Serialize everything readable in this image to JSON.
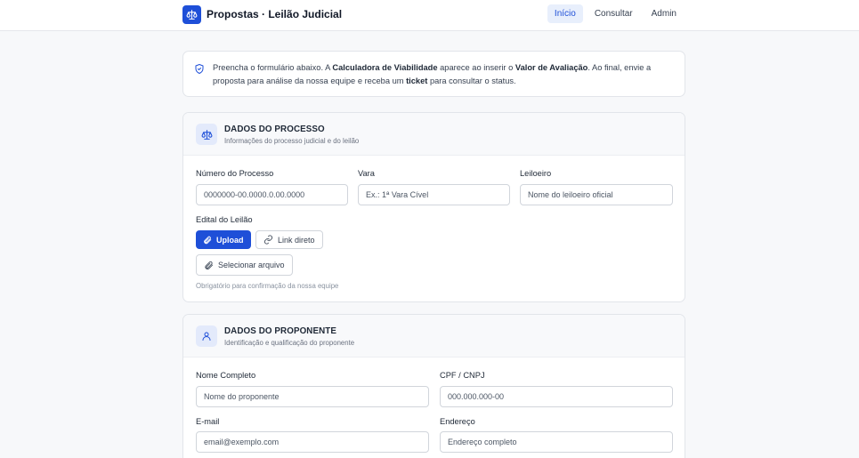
{
  "header": {
    "title": "Propostas · Leilão Judicial",
    "nav": [
      {
        "label": "Início"
      },
      {
        "label": "Consultar"
      },
      {
        "label": "Admin"
      }
    ]
  },
  "notice": {
    "t1": "Preencha o formulário abaixo. A ",
    "b1": "Calculadora de Viabilidade",
    "t2": " aparece ao inserir o ",
    "b2": "Valor de Avaliação",
    "t3": ". Ao final, envie a proposta para análise da nossa equipe e receba um ",
    "b3": "ticket",
    "t4": " para consultar o status."
  },
  "processo": {
    "title": "DADOS DO PROCESSO",
    "subtitle": "Informações do processo judicial e do leilão",
    "numero_label": "Número do Processo",
    "numero_placeholder": "0000000-00.0000.0.00.0000",
    "vara_label": "Vara",
    "vara_placeholder": "Ex.: 1ª Vara Cível",
    "leiloeiro_label": "Leiloeiro",
    "leiloeiro_placeholder": "Nome do leiloeiro oficial",
    "edital_label": "Edital do Leilão",
    "upload_label": "Upload",
    "link_label": "Link direto",
    "select_label": "Selecionar arquivo",
    "hint": "Obrigatório para confirmação da nossa equipe"
  },
  "proponente": {
    "title": "DADOS DO PROPONENTE",
    "subtitle": "Identificação e qualificação do proponente",
    "nome_label": "Nome Completo",
    "nome_placeholder": "Nome do proponente",
    "cpf_label": "CPF / CNPJ",
    "cpf_placeholder": "000.000.000-00",
    "email_label": "E-mail",
    "email_placeholder": "email@exemplo.com",
    "endereco_label": "Endereço",
    "endereco_placeholder": "Endereço completo"
  }
}
